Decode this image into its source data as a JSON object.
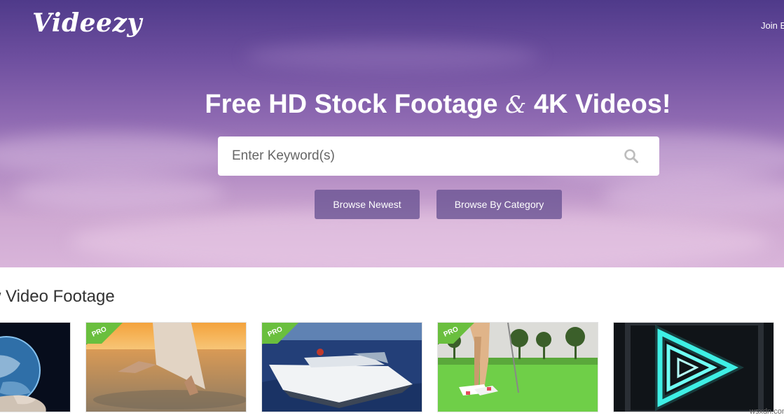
{
  "header": {
    "logo": "Videezy",
    "join_link": "Join E"
  },
  "hero": {
    "headline_part1": "Free HD Stock Footage ",
    "headline_amp": "&",
    "headline_part2": " 4K Videos!",
    "search": {
      "placeholder": "Enter Keyword(s)",
      "icon": "search-icon"
    },
    "buttons": {
      "browse_newest": "Browse Newest",
      "browse_category": "Browse By Category"
    }
  },
  "section": {
    "title": "w Video Footage"
  },
  "videos": [
    {
      "subject": "globe-in-hands",
      "pro": false
    },
    {
      "subject": "beach-sunset-walk",
      "pro": true,
      "badge": "PRO"
    },
    {
      "subject": "speedboat",
      "pro": true,
      "badge": "PRO"
    },
    {
      "subject": "golf-legs",
      "pro": true,
      "badge": "PRO"
    },
    {
      "subject": "neon-triangle",
      "pro": false
    }
  ],
  "watermark": "wsxdn.com",
  "colors": {
    "hero_top": "#4f3a8a",
    "hero_bottom": "#d9b5da",
    "button_bg": "#6d5593",
    "pro_green": "#6abf3e"
  }
}
